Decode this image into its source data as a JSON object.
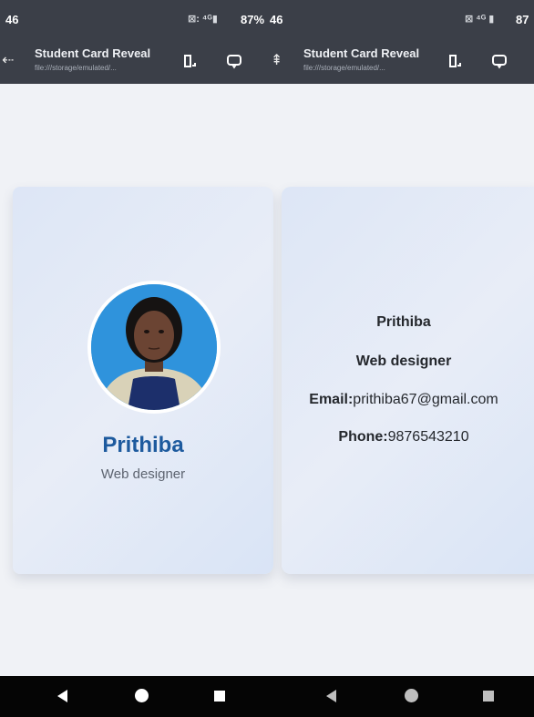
{
  "status_bar": {
    "left_time": "46",
    "left_icons": "⊠: ⁴ᴳ▮",
    "left_battery": "87%",
    "right_time": "46",
    "right_icons": "⊠ ⁴ᴳ ▮",
    "right_battery": "87"
  },
  "app_bar": {
    "title": "Student Card Reveal",
    "subtitle": "file:///storage/emulated/..."
  },
  "front_card": {
    "name": "Prithiba",
    "role": "Web designer"
  },
  "back_card": {
    "name": "Prithiba",
    "role": "Web designer",
    "email_label": "Email:",
    "email_value": "prithiba67@gmail.com",
    "phone_label": "Phone:",
    "phone_value": "9876543210"
  },
  "icons": {
    "back": "back-arrow-icon",
    "bookmark": "bookmark-icon",
    "comment": "comment-icon",
    "nav_back": "nav-back-icon",
    "nav_home": "nav-home-icon",
    "nav_recents": "nav-recents-icon"
  },
  "colors": {
    "top_bar": "#3b3f48",
    "card_gradient_start": "#dde6f6",
    "name_blue": "#1d5a9e",
    "nav_bar": "#050505"
  }
}
